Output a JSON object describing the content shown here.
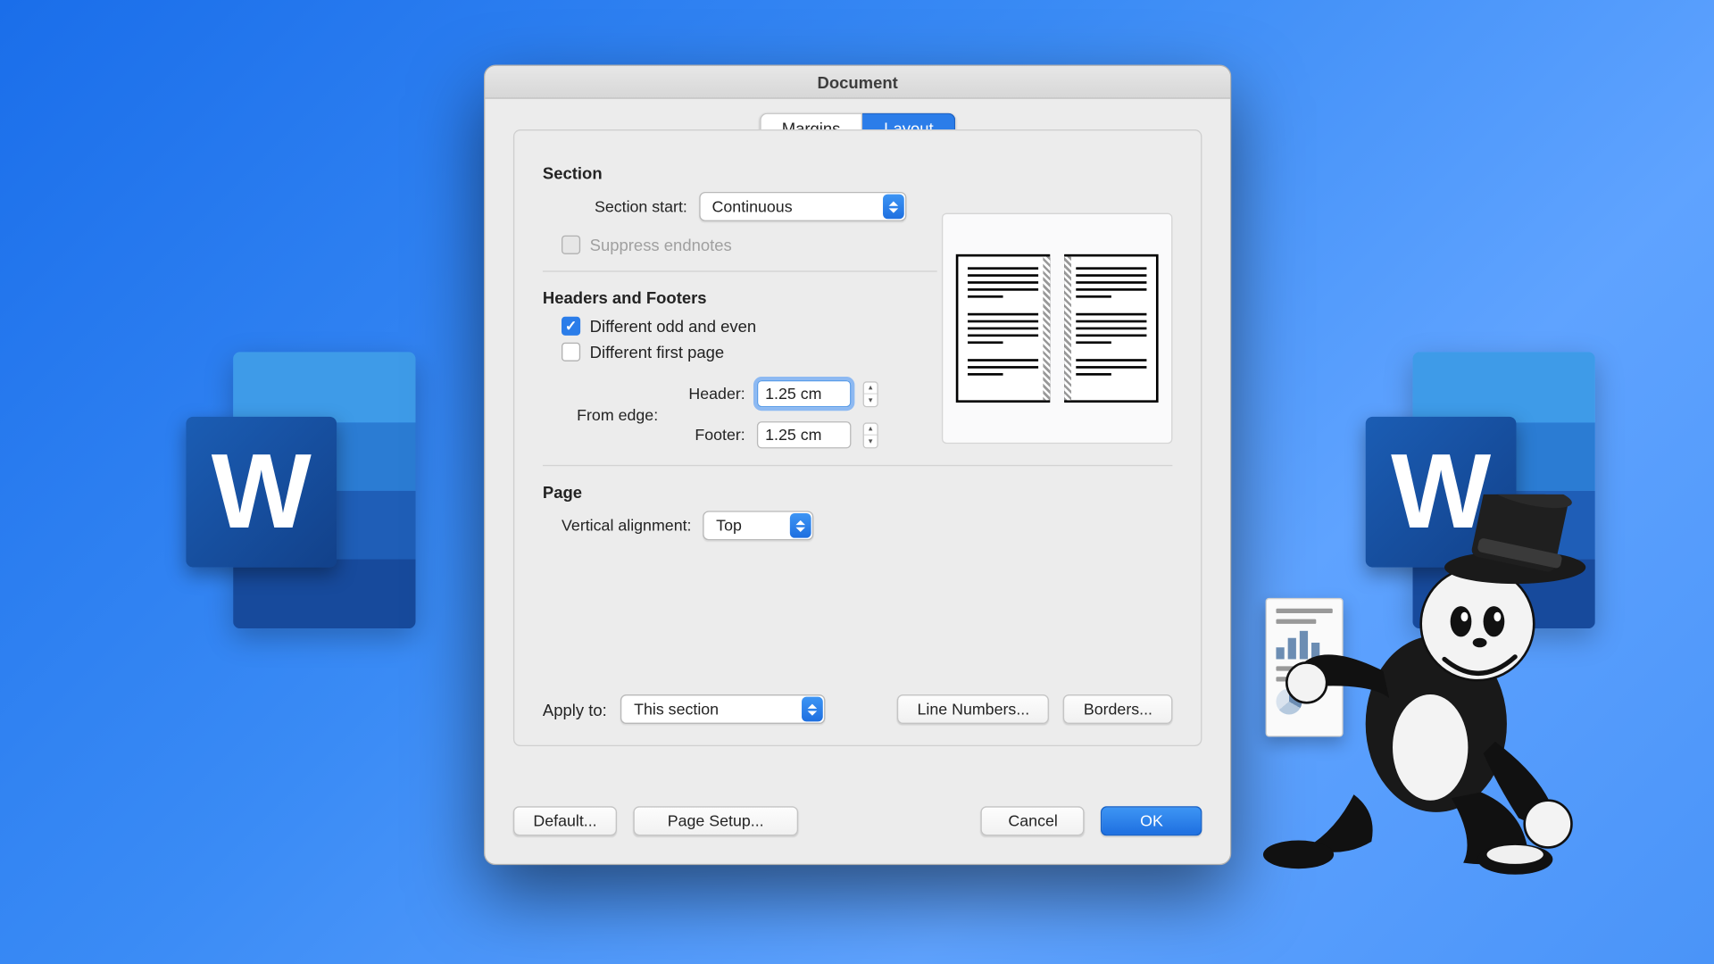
{
  "dialog": {
    "title": "Document",
    "tabs": {
      "margins": "Margins",
      "layout": "Layout"
    },
    "section": {
      "heading": "Section",
      "start_label": "Section start:",
      "start_value": "Continuous",
      "suppress": "Suppress endnotes"
    },
    "hf": {
      "heading": "Headers and Footers",
      "odd_even": "Different odd and even",
      "first_page": "Different first page",
      "from_edge": "From edge:",
      "header_label": "Header:",
      "header_value": "1.25 cm",
      "footer_label": "Footer:",
      "footer_value": "1.25 cm"
    },
    "page": {
      "heading": "Page",
      "valign_label": "Vertical alignment:",
      "valign_value": "Top"
    },
    "apply": {
      "label": "Apply to:",
      "value": "This section",
      "line_numbers": "Line Numbers...",
      "borders": "Borders..."
    },
    "footer": {
      "default": "Default...",
      "page_setup": "Page Setup...",
      "cancel": "Cancel",
      "ok": "OK"
    }
  }
}
